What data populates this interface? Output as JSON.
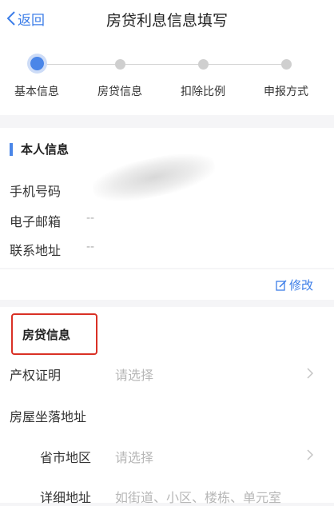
{
  "nav": {
    "back_label": "返回",
    "title": "房贷利息信息填写"
  },
  "steps": [
    {
      "label": "基本信息",
      "active": true
    },
    {
      "label": "房贷信息",
      "active": false
    },
    {
      "label": "扣除比例",
      "active": false
    },
    {
      "label": "申报方式",
      "active": false
    }
  ],
  "personal": {
    "title": "本人信息",
    "phone_label": "手机号码",
    "email_label": "电子邮箱",
    "email_value": "--",
    "address_label": "联系地址",
    "address_value": "--"
  },
  "edit_label": "修改",
  "loan": {
    "title": "房贷信息",
    "property_label": "产权证明",
    "property_placeholder": "请选择",
    "location_label": "房屋坐落地址",
    "region_label": "省市地区",
    "region_placeholder": "请选择",
    "detail_label": "详细地址",
    "detail_placeholder": "如街道、小区、楼栋、单元室"
  },
  "colors": {
    "accent": "#4a86e8",
    "highlight_box": "#d93025"
  }
}
